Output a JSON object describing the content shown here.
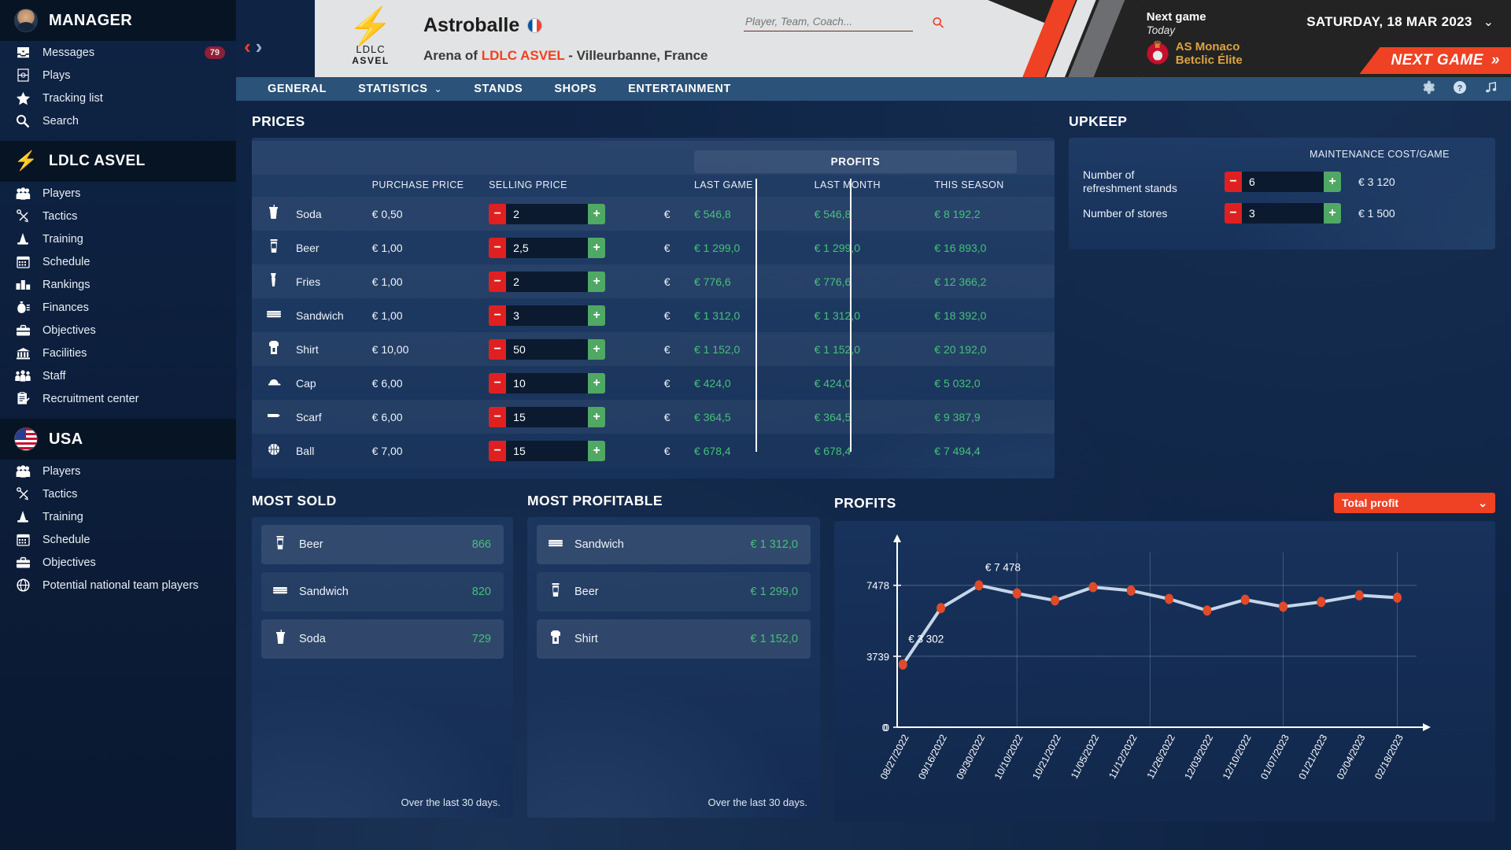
{
  "sidebar": {
    "manager": {
      "label": "MANAGER",
      "icon": "avatar"
    },
    "manager_items": [
      {
        "label": "Messages",
        "icon": "inbox-icon",
        "badge": "79"
      },
      {
        "label": "Plays",
        "icon": "court-icon",
        "badge": ""
      },
      {
        "label": "Tracking list",
        "icon": "star-icon",
        "badge": ""
      },
      {
        "label": "Search",
        "icon": "search-icon",
        "badge": ""
      }
    ],
    "club": {
      "label": "LDLC ASVEL",
      "icon": "club-logo-icon"
    },
    "club_items": [
      {
        "label": "Players",
        "icon": "people-icon"
      },
      {
        "label": "Tactics",
        "icon": "tactics-icon"
      },
      {
        "label": "Training",
        "icon": "cone-icon"
      },
      {
        "label": "Schedule",
        "icon": "calendar-icon"
      },
      {
        "label": "Rankings",
        "icon": "podium-icon"
      },
      {
        "label": "Finances",
        "icon": "money-bag-icon"
      },
      {
        "label": "Objectives",
        "icon": "briefcase-icon"
      },
      {
        "label": "Facilities",
        "icon": "building-icon"
      },
      {
        "label": "Staff",
        "icon": "staff-icon"
      },
      {
        "label": "Recruitment center",
        "icon": "clipboard-icon"
      }
    ],
    "nation": {
      "label": "USA",
      "icon": "flag-usa-icon"
    },
    "nation_items": [
      {
        "label": "Players",
        "icon": "people-icon"
      },
      {
        "label": "Tactics",
        "icon": "tactics-icon"
      },
      {
        "label": "Training",
        "icon": "cone-icon"
      },
      {
        "label": "Schedule",
        "icon": "calendar-icon"
      },
      {
        "label": "Objectives",
        "icon": "briefcase-icon"
      },
      {
        "label": "Potential national team players",
        "icon": "globe-icon"
      }
    ]
  },
  "header": {
    "arena_name": "Astroballe",
    "arena_flag": "flag-france-icon",
    "arena_sub_prefix": "Arena of ",
    "arena_sub_club": "LDLC ASVEL",
    "arena_sub_suffix": " - Villeurbanne, France",
    "logo_mark": "⚡",
    "logo_line1": "LDLC",
    "logo_line2": "ASVEL",
    "search_placeholder": "Player, Team, Coach...",
    "next_game_title": "Next game",
    "next_game_when": "Today",
    "next_game_team": "AS Monaco",
    "next_game_comp": "Betclic Élite",
    "date": "SATURDAY, 18 MAR 2023",
    "next_game_button": "NEXT GAME",
    "next_game_button_chevron": "»"
  },
  "tabs": {
    "items": [
      {
        "label": "GENERAL",
        "has_caret": false,
        "active": false
      },
      {
        "label": "STATISTICS",
        "has_caret": true,
        "active": false
      },
      {
        "label": "STANDS",
        "has_caret": false,
        "active": false
      },
      {
        "label": "SHOPS",
        "has_caret": false,
        "active": true
      },
      {
        "label": "ENTERTAINMENT",
        "has_caret": false,
        "active": false
      }
    ],
    "right_icons": [
      "settings-icon",
      "help-icon",
      "music-icon"
    ]
  },
  "prices": {
    "title": "PRICES",
    "profits_group": "PROFITS",
    "columns": {
      "purchase": "PURCHASE PRICE",
      "selling": "SELLING PRICE",
      "last_game": "LAST GAME",
      "last_month": "LAST MONTH",
      "this_season": "THIS SEASON"
    },
    "currency": "€",
    "rows": [
      {
        "icon": "soda-icon",
        "name": "Soda",
        "purchase": "€ 0,50",
        "selling": "2",
        "last_game": "€ 546,8",
        "last_month": "€ 546,8",
        "this_season": "€ 8 192,2"
      },
      {
        "icon": "beer-icon",
        "name": "Beer",
        "purchase": "€ 1,00",
        "selling": "2,5",
        "last_game": "€ 1 299,0",
        "last_month": "€ 1 299,0",
        "this_season": "€ 16 893,0"
      },
      {
        "icon": "fries-icon",
        "name": "Fries",
        "purchase": "€ 1,00",
        "selling": "2",
        "last_game": "€ 776,6",
        "last_month": "€ 776,6",
        "this_season": "€ 12 366,2"
      },
      {
        "icon": "sandwich-icon",
        "name": "Sandwich",
        "purchase": "€ 1,00",
        "selling": "3",
        "last_game": "€ 1 312,0",
        "last_month": "€ 1 312,0",
        "this_season": "€ 18 392,0"
      },
      {
        "icon": "shirt-icon",
        "name": "Shirt",
        "purchase": "€ 10,00",
        "selling": "50",
        "last_game": "€ 1 152,0",
        "last_month": "€ 1 152,0",
        "this_season": "€ 20 192,0"
      },
      {
        "icon": "cap-icon",
        "name": "Cap",
        "purchase": "€ 6,00",
        "selling": "10",
        "last_game": "€ 424,0",
        "last_month": "€ 424,0",
        "this_season": "€ 5 032,0"
      },
      {
        "icon": "scarf-icon",
        "name": "Scarf",
        "purchase": "€ 6,00",
        "selling": "15",
        "last_game": "€ 364,5",
        "last_month": "€ 364,5",
        "this_season": "€ 9 387,9"
      },
      {
        "icon": "ball-icon",
        "name": "Ball",
        "purchase": "€ 7,00",
        "selling": "15",
        "last_game": "€ 678,4",
        "last_month": "€ 678,4",
        "this_season": "€ 7 494,4"
      }
    ]
  },
  "upkeep": {
    "title": "UPKEEP",
    "cost_header": "MAINTENANCE COST/GAME",
    "rows": [
      {
        "label": "Number of\nrefreshment stands",
        "label_l1": "Number of",
        "label_l2": "refreshment stands",
        "value": "6",
        "cost": "€ 3 120"
      },
      {
        "label": "Number of stores",
        "label_l1": "Number of stores",
        "label_l2": "",
        "value": "3",
        "cost": "€ 1 500"
      }
    ]
  },
  "most_sold": {
    "title": "MOST SOLD",
    "footer": "Over the last 30 days.",
    "rows": [
      {
        "icon": "beer-icon",
        "name": "Beer",
        "value": "866"
      },
      {
        "icon": "sandwich-icon",
        "name": "Sandwich",
        "value": "820"
      },
      {
        "icon": "soda-icon",
        "name": "Soda",
        "value": "729"
      }
    ]
  },
  "most_profitable": {
    "title": "MOST PROFITABLE",
    "footer": "Over the last 30 days.",
    "rows": [
      {
        "icon": "sandwich-icon",
        "name": "Sandwich",
        "value": "€ 1 312,0"
      },
      {
        "icon": "beer-icon",
        "name": "Beer",
        "value": "€ 1 299,0"
      },
      {
        "icon": "shirt-icon",
        "name": "Shirt",
        "value": "€ 1 152,0"
      }
    ]
  },
  "profits_section": {
    "title": "PROFITS",
    "dropdown_value": "Total profit"
  },
  "colors": {
    "accent_red": "#ef4123",
    "green": "#46c07a",
    "gold": "#dba441",
    "nav_blue": "#2b5278",
    "panel_blue": "#1b3a6b"
  },
  "chart_data": {
    "type": "line",
    "title": "PROFITS",
    "xlabel": "",
    "ylabel": "",
    "grid": true,
    "legend": "none",
    "yticks": [
      0,
      3739,
      7478
    ],
    "ytick_labels": [
      "0",
      "3739",
      "7478"
    ],
    "ylim": [
      0,
      9000
    ],
    "annotations": [
      {
        "text": "€ 7 478",
        "x_index": 2,
        "y": 7478
      },
      {
        "text": "€ 3 302",
        "x_index": 0,
        "y": 3302
      }
    ],
    "categories": [
      "08/27/2022",
      "09/16/2022",
      "09/30/2022",
      "10/10/2022",
      "10/21/2022",
      "11/05/2022",
      "11/12/2022",
      "11/26/2022",
      "12/03/2022",
      "12/10/2022",
      "01/07/2023",
      "01/21/2023",
      "02/04/2023",
      "02/18/2023"
    ],
    "values": [
      3302,
      6280,
      7478,
      7050,
      6680,
      7380,
      7200,
      6760,
      6150,
      6720,
      6350,
      6600,
      6950,
      6830
    ],
    "marker_color": "#e04a28",
    "line_color": "#c5d6e8"
  }
}
